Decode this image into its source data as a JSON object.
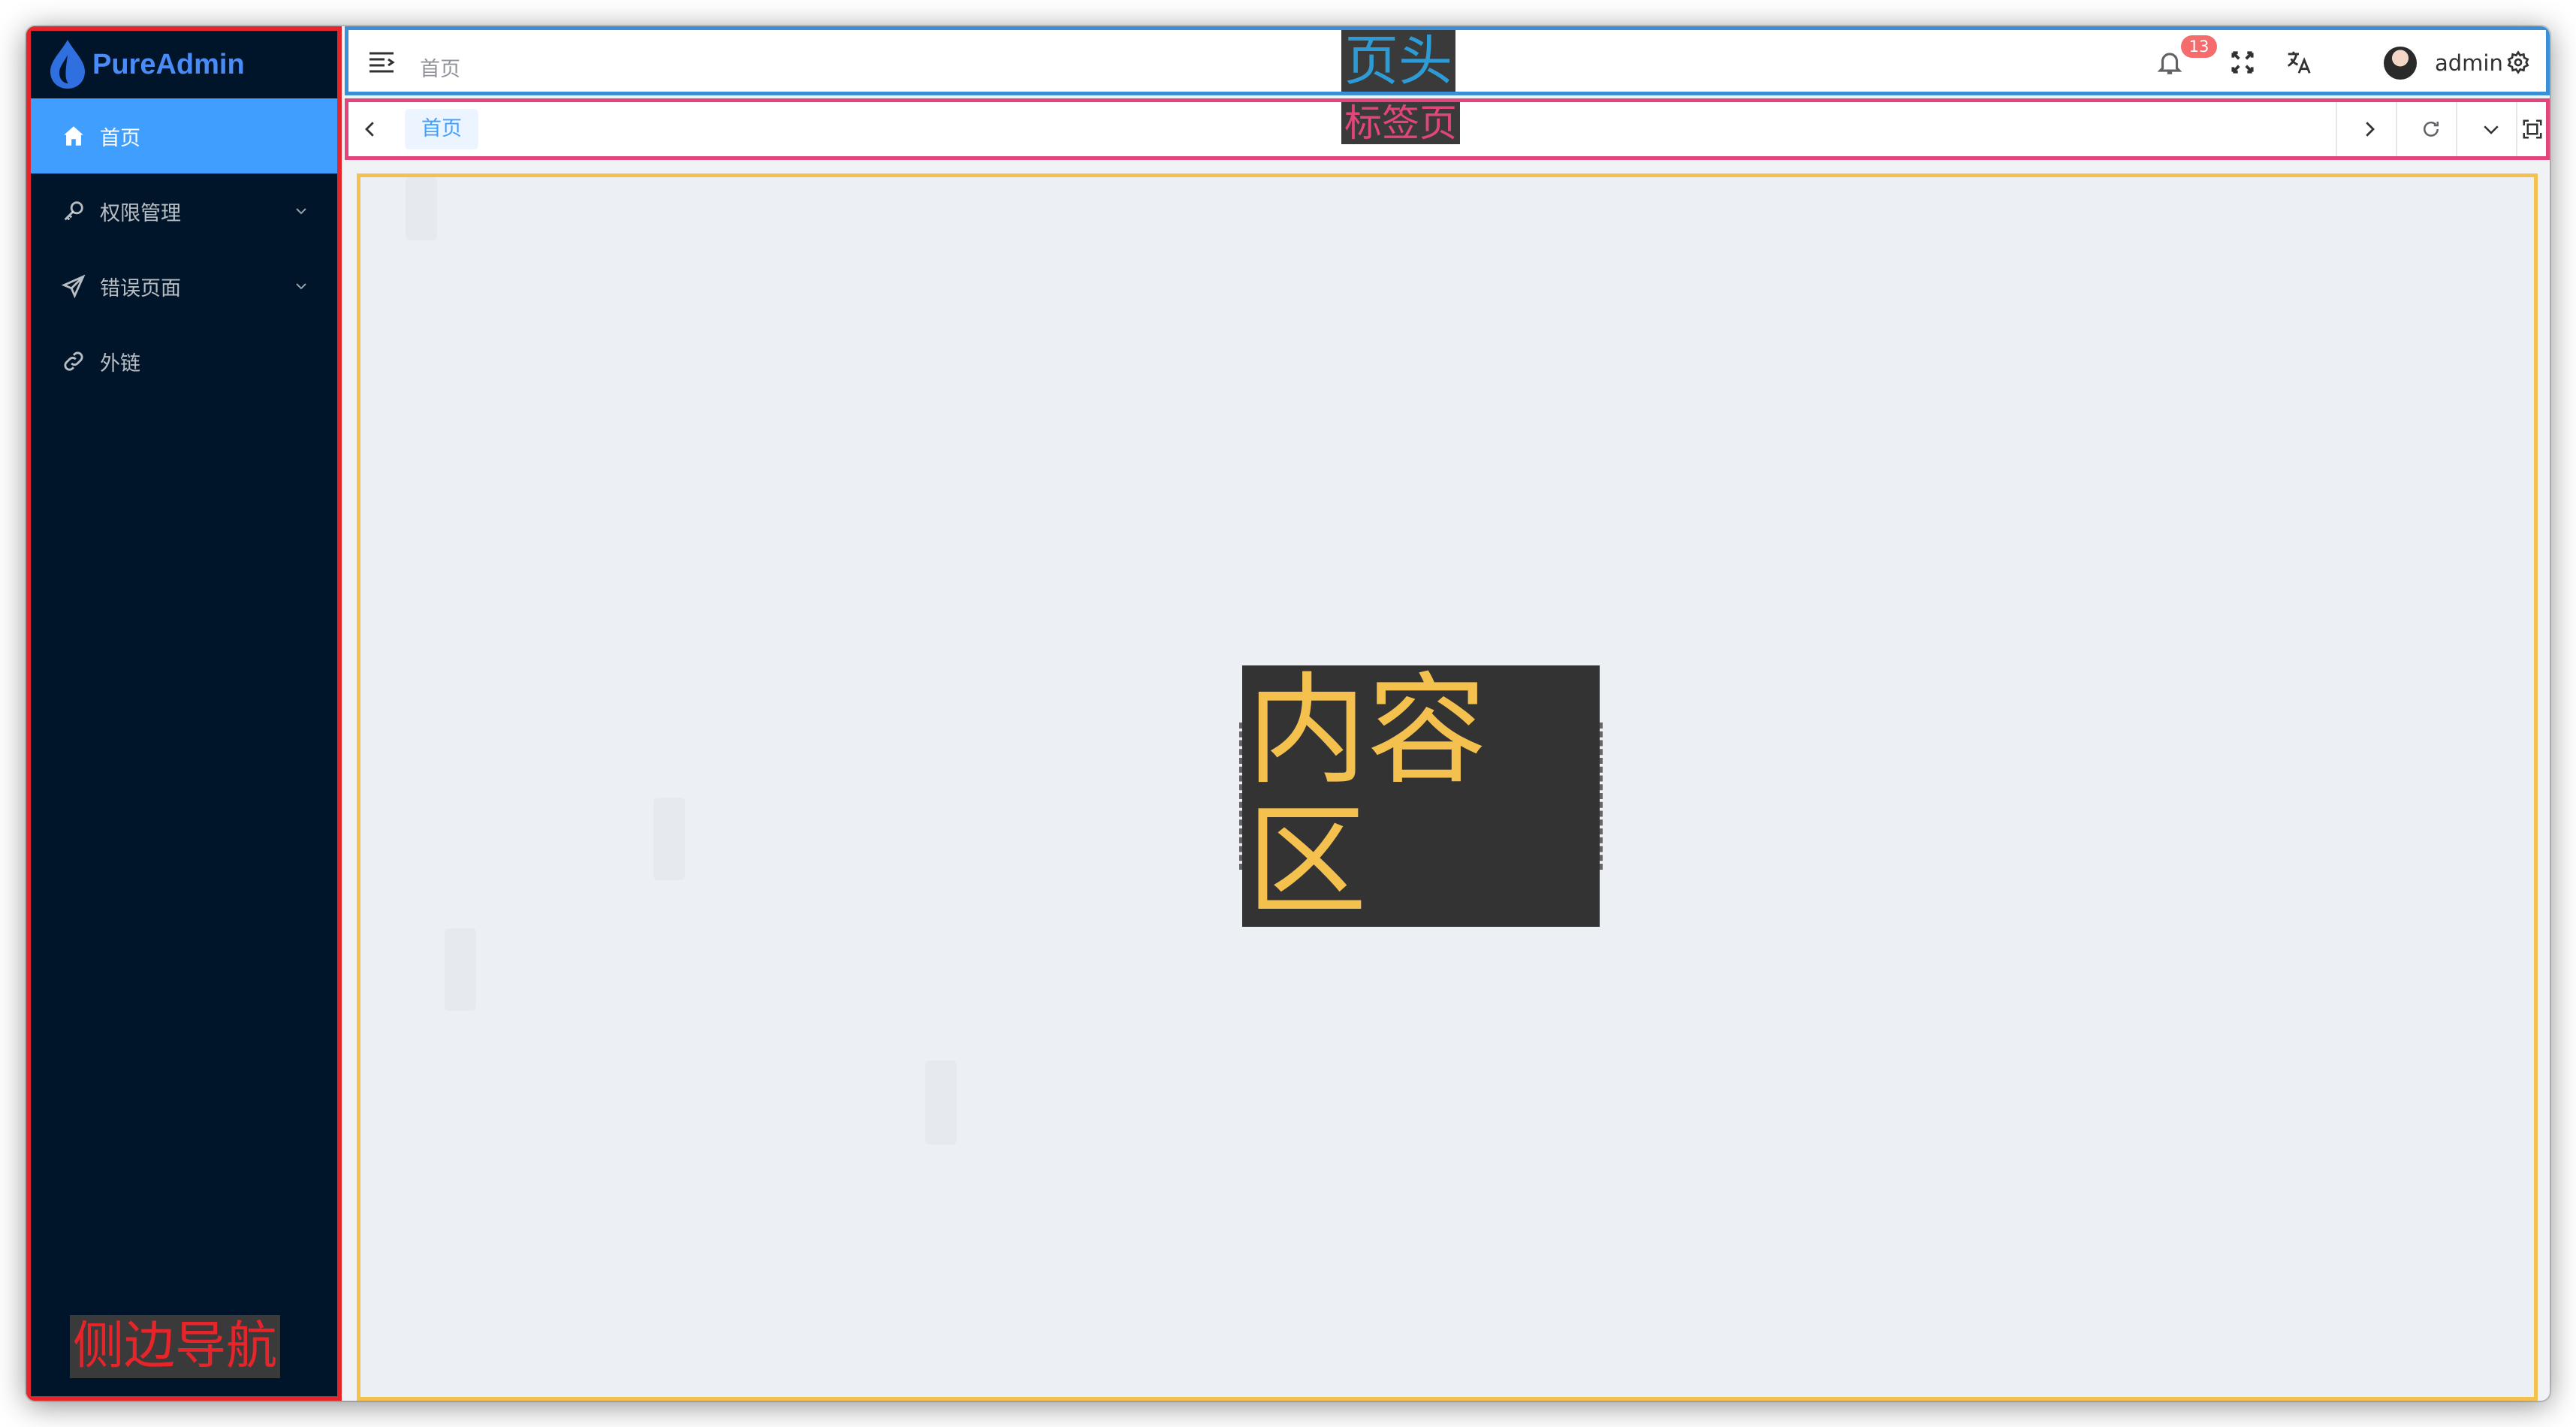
{
  "app": {
    "logo_text": "PureAdmin"
  },
  "sidebar": {
    "items": [
      {
        "label": "首页",
        "icon": "home-icon",
        "active": true,
        "has_submenu": false
      },
      {
        "label": "权限管理",
        "icon": "key-icon",
        "active": false,
        "has_submenu": true
      },
      {
        "label": "错误页面",
        "icon": "send-icon",
        "active": false,
        "has_submenu": true
      },
      {
        "label": "外链",
        "icon": "link-icon",
        "active": false,
        "has_submenu": false
      }
    ],
    "region_label": "侧边导航"
  },
  "header": {
    "breadcrumb": "首页",
    "region_label": "页头",
    "notification_count": "13",
    "username": "admin"
  },
  "tags": {
    "items": [
      {
        "label": "首页"
      }
    ],
    "region_label": "标签页"
  },
  "content": {
    "region_label": "内容区"
  },
  "colors": {
    "sidebar_bg": "#001529",
    "active_menu": "#409eff",
    "sidebar_border": "#e5252a",
    "header_border": "#3a8fd6",
    "tags_border": "#e1457b",
    "content_border": "#f4c04e",
    "badge": "#f56c6c"
  }
}
